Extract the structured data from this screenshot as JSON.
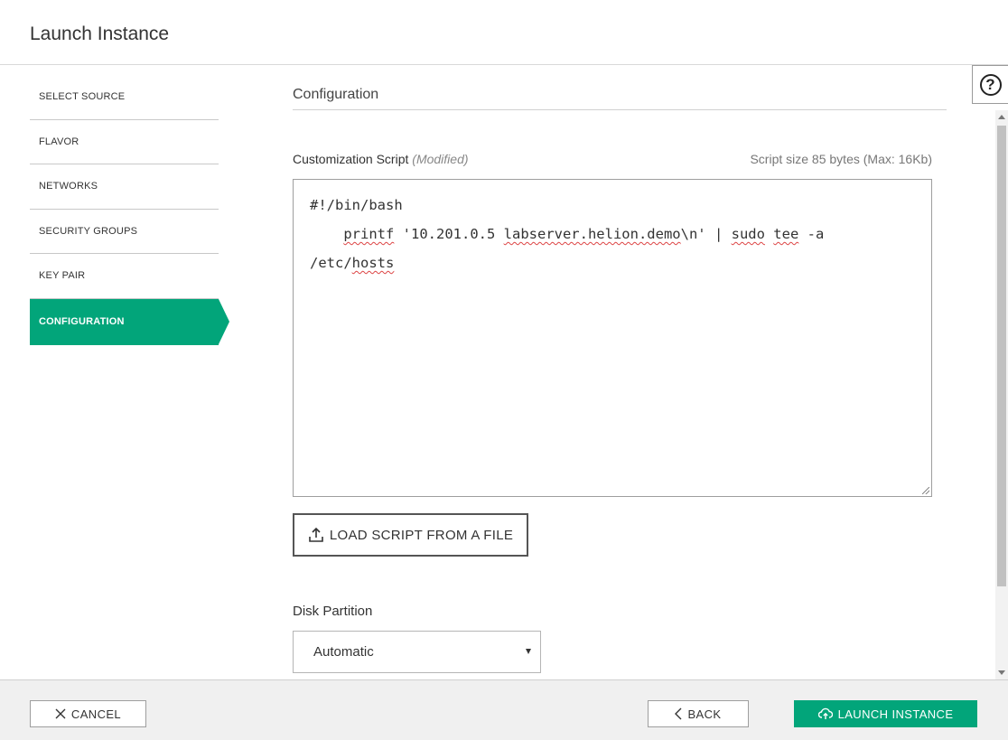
{
  "header": {
    "title": "Launch Instance"
  },
  "help": {
    "label": "?"
  },
  "nav": {
    "items": [
      {
        "label": "SELECT SOURCE",
        "active": false
      },
      {
        "label": "FLAVOR",
        "active": false
      },
      {
        "label": "NETWORKS",
        "active": false
      },
      {
        "label": "SECURITY GROUPS",
        "active": false
      },
      {
        "label": "KEY PAIR",
        "active": false
      },
      {
        "label": "CONFIGURATION",
        "active": true
      }
    ]
  },
  "config": {
    "section_title": "Configuration",
    "script_label": "Customization Script",
    "script_modified": "(Modified)",
    "script_size": "Script size 85 bytes (Max: 16Kb)",
    "script": {
      "line1": "#!/bin/bash",
      "line2_indent": "    ",
      "w_printf": "printf",
      "s_quote_ip": " '10.201.0.5 ",
      "w_host": "labserver.helion.demo",
      "s_nl": "\\n' | ",
      "w_sudo": "sudo",
      "s_sp": " ",
      "w_tee": "tee",
      "s_flag": " -a",
      "line3_prefix": "/etc/",
      "w_hosts": "hosts"
    },
    "load_button": "LOAD SCRIPT FROM A FILE",
    "disk_label": "Disk Partition",
    "disk_value": "Automatic"
  },
  "footer": {
    "cancel": "CANCEL",
    "back": "BACK",
    "launch": "LAUNCH INSTANCE"
  },
  "colors": {
    "accent": "#02a57a",
    "border": "#9e9e9e",
    "footer_bg": "#f0f0f0"
  },
  "icons": {
    "help": "question-circle-icon",
    "upload": "upload-icon",
    "cancel": "close-icon",
    "back": "chevron-left-icon",
    "launch": "cloud-upload-icon",
    "select": "caret-down-icon"
  }
}
